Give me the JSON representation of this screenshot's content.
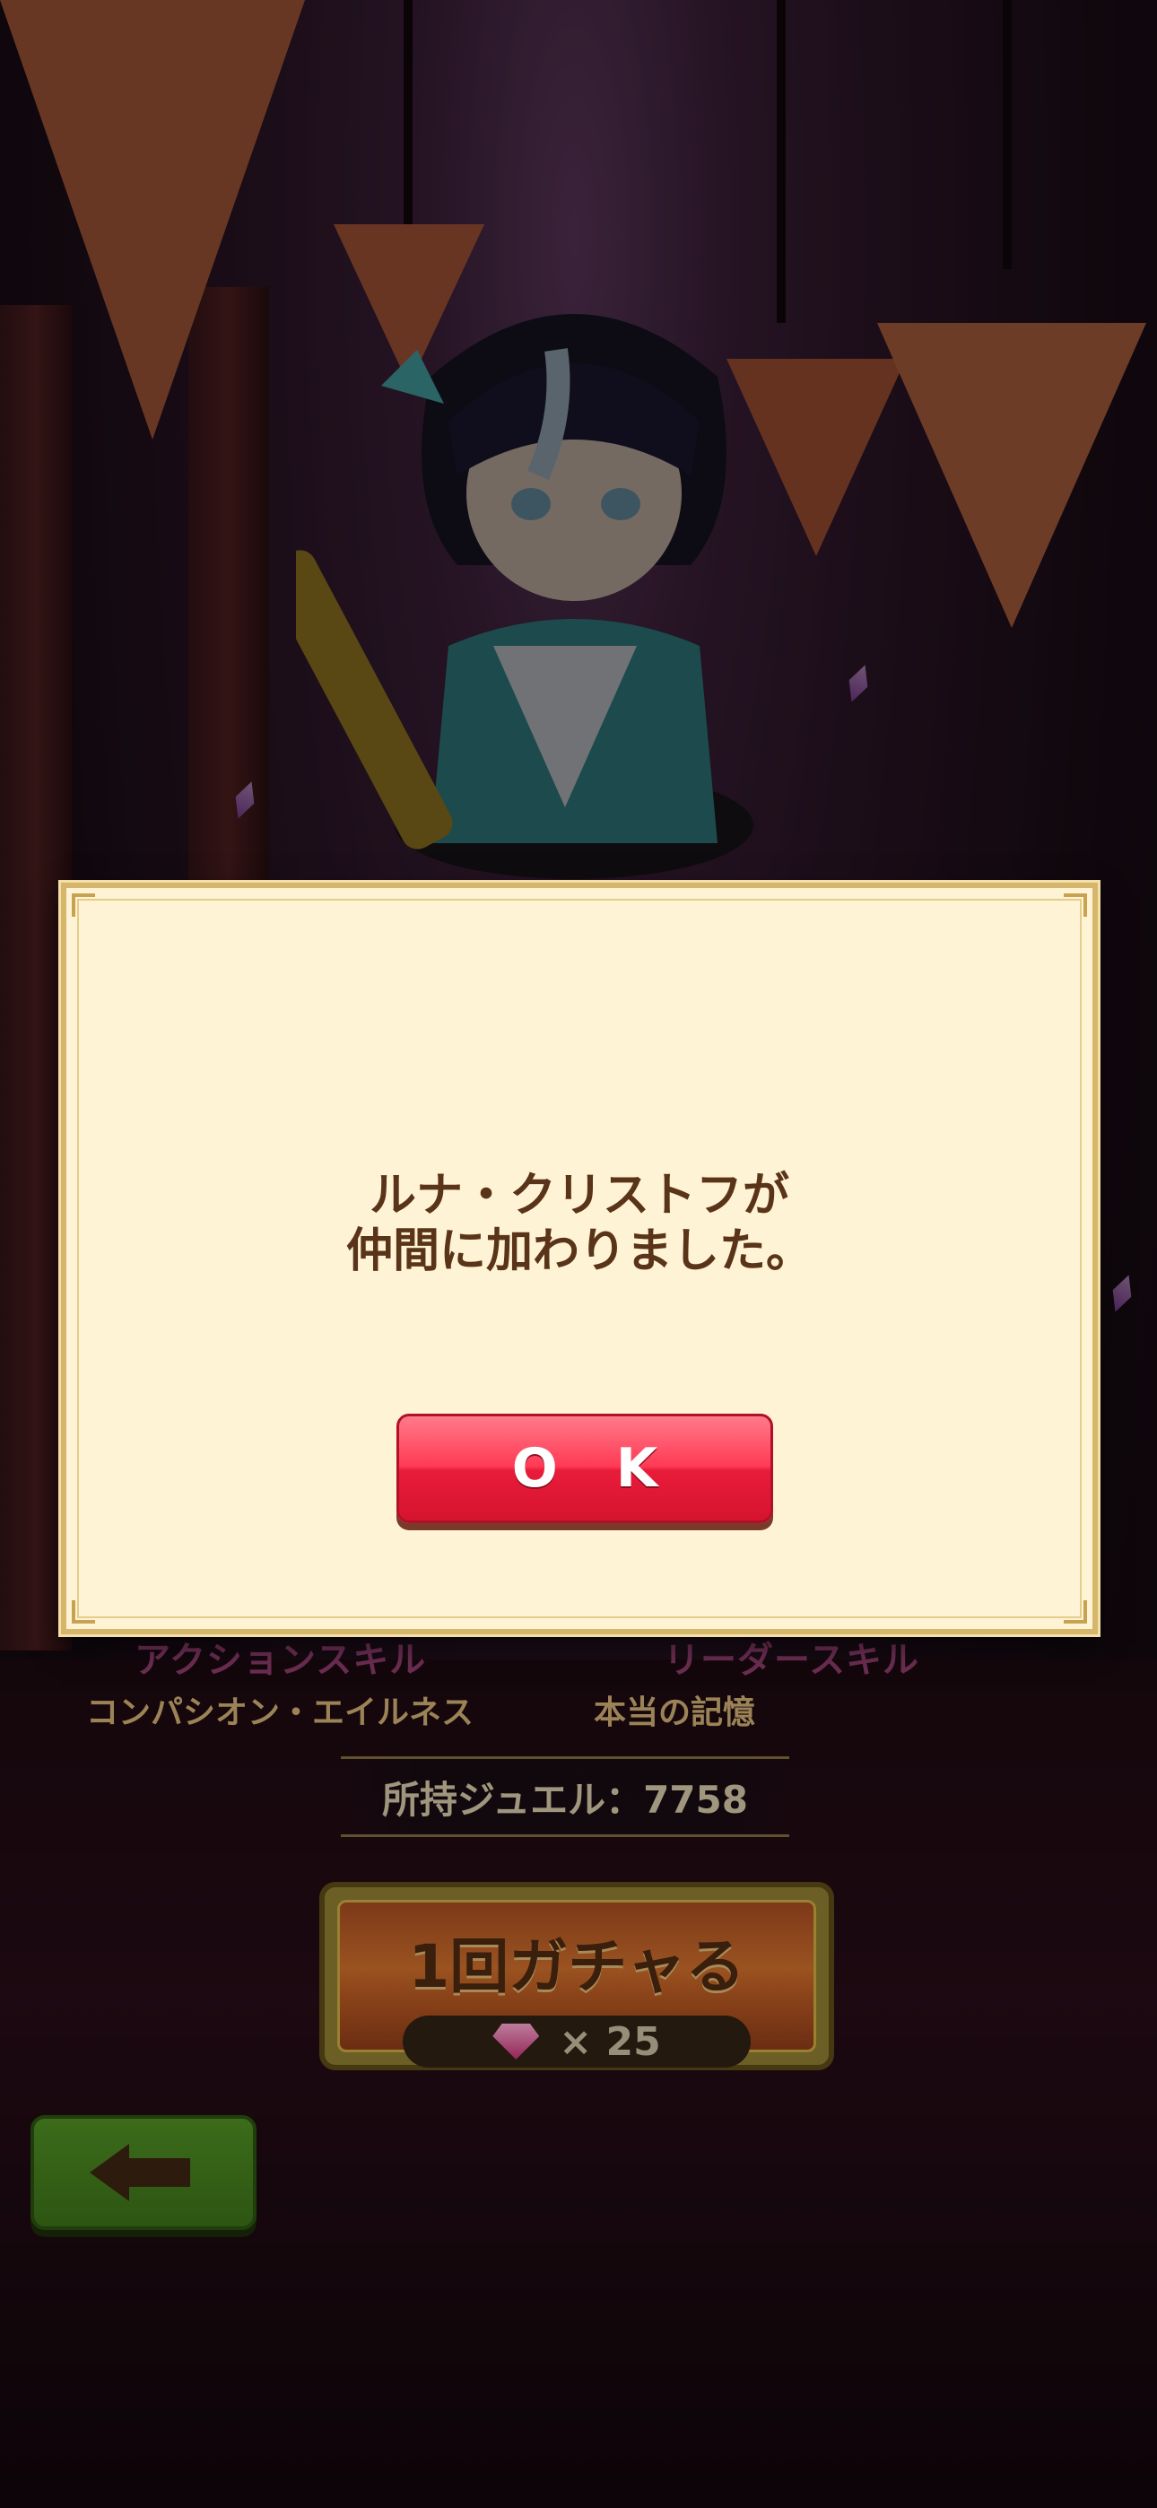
{
  "dialog": {
    "message_line1": "ルナ・クリストフが",
    "message_line2": "仲間に加わりました。",
    "ok_label": "O K"
  },
  "skills": {
    "action_heading": "アクションスキル",
    "leader_heading": "リーダースキル",
    "action_name": "コンパシオン・エイルネス",
    "leader_name": "本当の記憶"
  },
  "jewel": {
    "label": "所持ジュエル：7758"
  },
  "gacha_button": {
    "title": "1回ガチャる",
    "cost": "× 25",
    "icon": "gem-icon"
  },
  "back_button": {
    "icon": "back-arrow-icon"
  },
  "colors": {
    "ok_button": "#ff3a55",
    "dialog_bg": "#fff3d6",
    "back_button": "#4d8a22",
    "gacha_button": "#c66a2a"
  }
}
